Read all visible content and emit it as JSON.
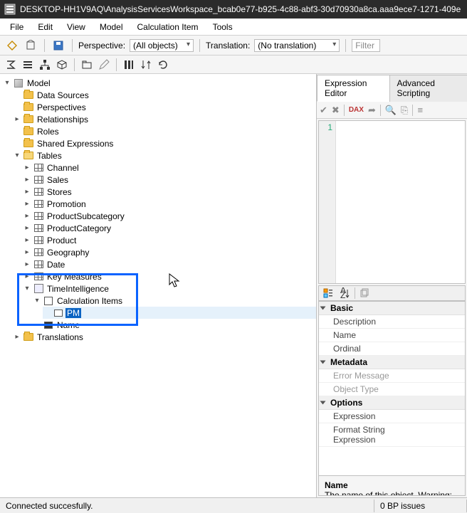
{
  "title": "DESKTOP-HH1V9AQ\\AnalysisServicesWorkspace_bcab0e77-b925-4c88-abf3-30d70930a8ca.aaa9ece7-1271-409e",
  "menu": {
    "file": "File",
    "edit": "Edit",
    "view": "View",
    "model": "Model",
    "calcitem": "Calculation Item",
    "tools": "Tools"
  },
  "toolbar": {
    "perspective_label": "Perspective:",
    "perspective_value": "(All objects)",
    "translation_label": "Translation:",
    "translation_value": "(No translation)",
    "filter_placeholder": "Filter"
  },
  "tree": {
    "root": "Model",
    "data_sources": "Data Sources",
    "perspectives": "Perspectives",
    "relationships": "Relationships",
    "roles": "Roles",
    "shared_expr": "Shared Expressions",
    "tables": "Tables",
    "tables_children": [
      "Channel",
      "Sales",
      "Stores",
      "Promotion",
      "ProductSubcategory",
      "ProductCategory",
      "Product",
      "Geography",
      "Date",
      "Key Measures"
    ],
    "time_intel": "TimeIntelligence",
    "calc_items": "Calculation Items",
    "calc_item_editing": "PM",
    "calc_item_name": "Name",
    "translations": "Translations"
  },
  "tabs": {
    "expr": "Expression Editor",
    "adv": "Advanced Scripting"
  },
  "editor": {
    "line1": "1"
  },
  "props": {
    "cat_basic": "Basic",
    "basic": [
      {
        "k": "Description"
      },
      {
        "k": "Name"
      },
      {
        "k": "Ordinal"
      }
    ],
    "cat_meta": "Metadata",
    "meta": [
      {
        "k": "Error Message"
      },
      {
        "k": "Object Type"
      }
    ],
    "cat_opts": "Options",
    "opts": [
      {
        "k": "Expression"
      },
      {
        "k": "Format String Expression"
      }
    ]
  },
  "help": {
    "title": "Name",
    "text": "The name of this object. Warning: Changin"
  },
  "status": {
    "left": "Connected succesfully.",
    "right": "0 BP issues"
  },
  "icons": {
    "dax": "DAX"
  }
}
